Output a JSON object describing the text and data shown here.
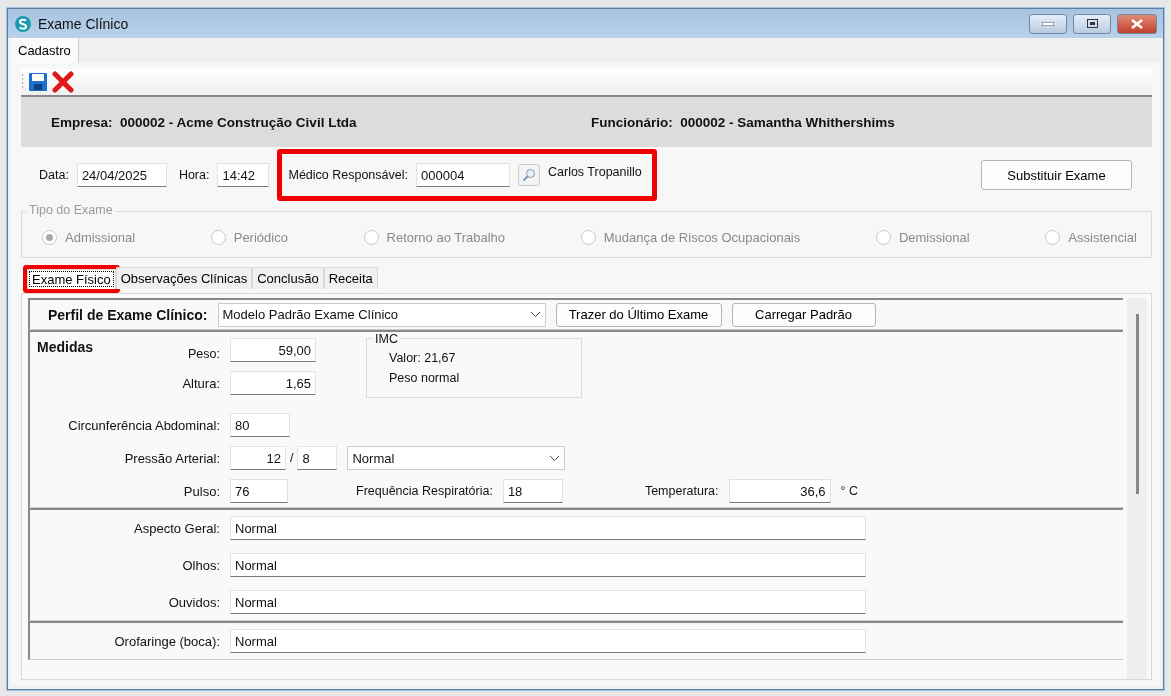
{
  "window": {
    "title": "Exame Clínico"
  },
  "menu_tabs": [
    {
      "label": "Cadastro",
      "selected": true
    }
  ],
  "header": {
    "empresa_label": "Empresa:",
    "empresa": "000002 - Acme Construção Civil Ltda",
    "funcionario_label": "Funcionário:",
    "funcionario": "000002 - Samantha Whithershims"
  },
  "exam_info": {
    "data_label": "Data:",
    "data": "24/04/2025",
    "hora_label": "Hora:",
    "hora": "14:42",
    "medico_label": "Médico Responsável:",
    "medico_code": "000004",
    "medico_name": "Carlos Tropanillo",
    "highlighted": true,
    "replace_button": "Substituir Exame"
  },
  "tipo_exame": {
    "title": "Tipo do Exame",
    "disabled": true,
    "options": [
      {
        "label": "Admissional",
        "selected": true
      },
      {
        "label": "Periódico",
        "selected": false
      },
      {
        "label": "Retorno ao Trabalho",
        "selected": false
      },
      {
        "label": "Mudança de Riscos Ocupacionais",
        "selected": false
      },
      {
        "label": "Demissional",
        "selected": false
      },
      {
        "label": "Assistencial",
        "selected": false
      }
    ]
  },
  "tabs": [
    {
      "label": "Exame Físico",
      "selected": true,
      "highlighted": true
    },
    {
      "label": "Observações Clínicas",
      "selected": false,
      "highlighted": false
    },
    {
      "label": "Conclusão",
      "selected": false,
      "highlighted": false
    },
    {
      "label": "Receita",
      "selected": false,
      "highlighted": false
    }
  ],
  "perfil": {
    "label": "Perfil de Exame Clínico:",
    "value": "Modelo Padrão Exame Clínico",
    "buttons": [
      "Trazer do Último Exame",
      "Carregar Padrão"
    ]
  },
  "medidas": {
    "title": "Medidas",
    "peso_label": "Peso:",
    "peso": "59,00",
    "altura_label": "Altura:",
    "altura": "1,65",
    "imc": {
      "title": "IMC",
      "valor": "Valor: 21,67",
      "classificacao": "Peso normal"
    },
    "circ_label": "Circunferência Abdominal:",
    "circ": "80",
    "pressao_label": "Pressão Arterial:",
    "sistolica": "12",
    "separator": "/",
    "diastolica": "8",
    "pressao_status": "Normal",
    "pulso_label": "Pulso:",
    "pulso": "76",
    "freq_label": "Frequência Respiratória:",
    "freq": "18",
    "temp_label": "Temperatura:",
    "temp": "36,6",
    "temp_unit": "° C"
  },
  "exam_groups": [
    {
      "fields": [
        {
          "label": "Aspecto Geral:",
          "value": "Normal"
        },
        {
          "label": "Olhos:",
          "value": "Normal"
        },
        {
          "label": "Ouvidos:",
          "value": "Normal"
        }
      ]
    },
    {
      "fields": [
        {
          "label": "Orofaringe (boca):",
          "value": "Normal"
        }
      ]
    }
  ]
}
